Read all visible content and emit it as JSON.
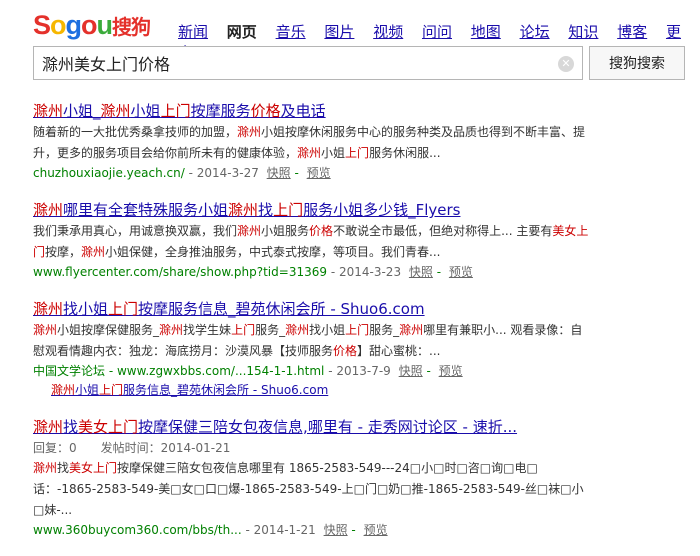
{
  "logo": {
    "text": "Sogou搜狗"
  },
  "nav": {
    "items": [
      "新闻",
      "网页",
      "音乐",
      "图片",
      "视频",
      "问问",
      "地图",
      "论坛",
      "知识",
      "博客"
    ],
    "current": "网页",
    "more": "更多"
  },
  "search": {
    "query": "滁州美女上门价格",
    "button": "搜狗搜索"
  },
  "results": [
    {
      "title": "滁州小姐_滁州小姐上门按摩服务价格及电话",
      "desc": "随着新的一大批优秀桑拿技师的加盟，滁州小姐按摩休闲服务中心的服务种类及品质也得到不断丰富、提升，更多的服务项目会给你前所未有的健康体验，滁州小姐上门服务休闲服...",
      "url": "chuzhouxiaojie.yeach.cn/",
      "date": "- 2014-3-27",
      "snapshot": "快照",
      "preview": "预览"
    },
    {
      "title": "滁州哪里有全套特殊服务小姐滁州找上门服务小姐多少钱_Flyers",
      "desc": "我们秉承用真心，用诚意换双赢，我们滁州小姐服务价格不敢说全市最低，但绝对称得上... 主要有美女上门按摩，滁州小姐保健，全身推油服务，中式泰式按摩，等项目。我们青春...",
      "url": "www.flyercenter.com/share/show.php?tid=31369",
      "date": "- 2014-3-23",
      "snapshot": "快照",
      "preview": "预览"
    },
    {
      "title": "滁州找小姐上门按摩服务信息_碧苑休闲会所 - Shuo6.com",
      "desc": "滁州小姐按摩保健服务_滁州找学生妹上门服务_滁州找小姐上门服务_滁州哪里有兼职小... 观看录像：自慰观看情趣内衣：独龙：海底捞月：沙漠风暴【技师服务价格】甜心蜜桃：...",
      "site": "中国文学论坛 -",
      "url": "www.zgwxbbs.com/...154-1-1.html",
      "date": "- 2013-7-9",
      "snapshot": "快照",
      "preview": "预览",
      "sublink": "滁州小姐上门服务信息_碧苑休闲会所 - Shuo6.com"
    },
    {
      "title": "滁州找美女上门按摩保健三陪女包夜信息,哪里有 - 走秀网讨论区 - 速折...",
      "meta": "回复：0　　发帖时间：2014-01-21",
      "desc": "滁州找美女上门按摩保健三陪女包夜信息哪里有 1865-2583-549---24□小□时□咨□询□电□话：-1865-2583-549-美□女□口□爆-1865-2583-549-上□门□奶□推-1865-2583-549-丝□袜□小□妹-...",
      "url": "www.360buycom360.com/bbs/th...",
      "date": "- 2014-1-21",
      "snapshot": "快照",
      "preview": "预览"
    }
  ]
}
